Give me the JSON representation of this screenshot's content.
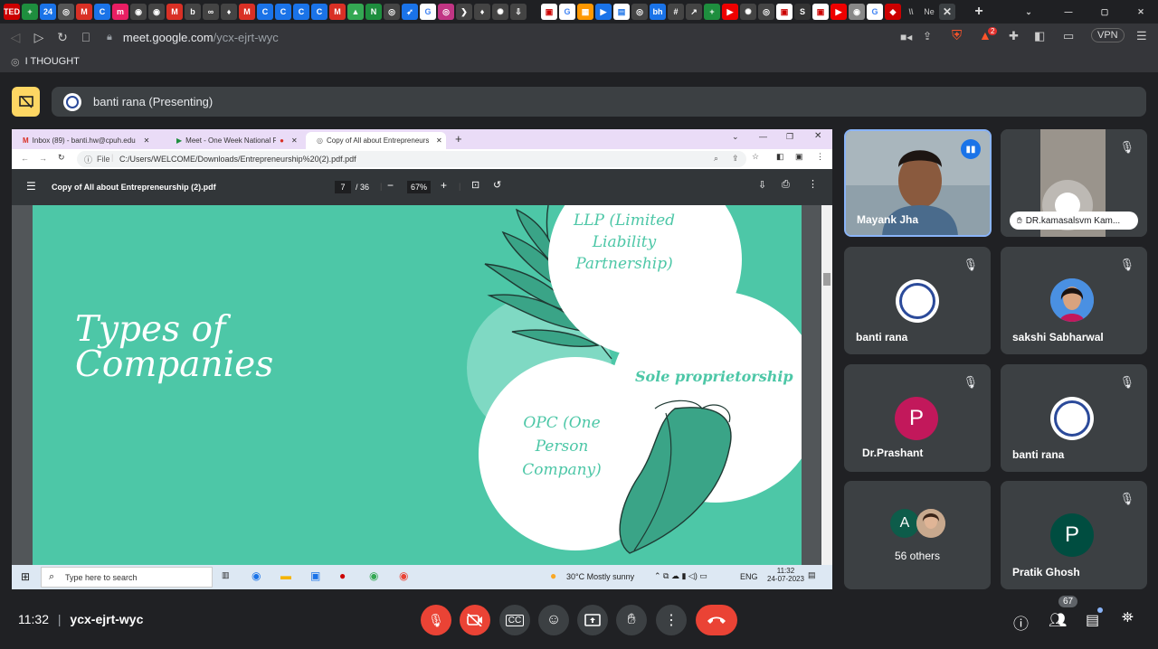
{
  "browser": {
    "url_host": "meet.google.com",
    "url_path": "/ycx-ejrt-wyc",
    "bookmark": "I THOUGHT",
    "vpn_label": "VPN",
    "notif_count": "2"
  },
  "meet": {
    "presenter_label": "banti rana (Presenting)",
    "time": "11:32",
    "separator": "|",
    "meeting_code": "ycx-ejrt-wyc",
    "participants_count": "67"
  },
  "shared_screen": {
    "tabs": [
      {
        "label": "Inbox (89) - banti.hw@cpuh.edu"
      },
      {
        "label": "Meet - One Week National F"
      },
      {
        "label": "Copy of All about Entrepreneurs"
      }
    ],
    "file_label": "File",
    "file_path": "C:/Users/WELCOME/Downloads/Entrepreneurship%20(2).pdf.pdf",
    "pdf_title": "Copy of All about Entrepreneurship (2).pdf",
    "page_current": "7",
    "page_total": "/ 36",
    "zoom": "67%",
    "slide": {
      "title_line1": "Types of",
      "title_line2": "Companies",
      "llp_line1": "LLP (Limited",
      "llp_line2": "Liability",
      "llp_line3": "Partnership)",
      "sole": "Sole proprietorship",
      "opc_line1": "OPC (One",
      "opc_line2": "Person",
      "opc_line3": "Company)"
    },
    "taskbar": {
      "search_placeholder": "Type here to search",
      "weather": "30°C  Mostly sunny",
      "lang": "ENG",
      "time": "11:32",
      "date": "24-07-2023"
    }
  },
  "participants": [
    {
      "name": "Mayank Jha"
    },
    {
      "name": "DR.kamasalsvm Kam..."
    },
    {
      "name": "banti rana"
    },
    {
      "name": "sakshi Sabharwal"
    },
    {
      "name": "Dr.Prashant",
      "initial": "P",
      "color": "#c2185b"
    },
    {
      "name": "banti rana"
    },
    {
      "name": "56 others",
      "initial": "A"
    },
    {
      "name": "Pratik Ghosh",
      "initial": "P",
      "color": "#004d40"
    }
  ]
}
